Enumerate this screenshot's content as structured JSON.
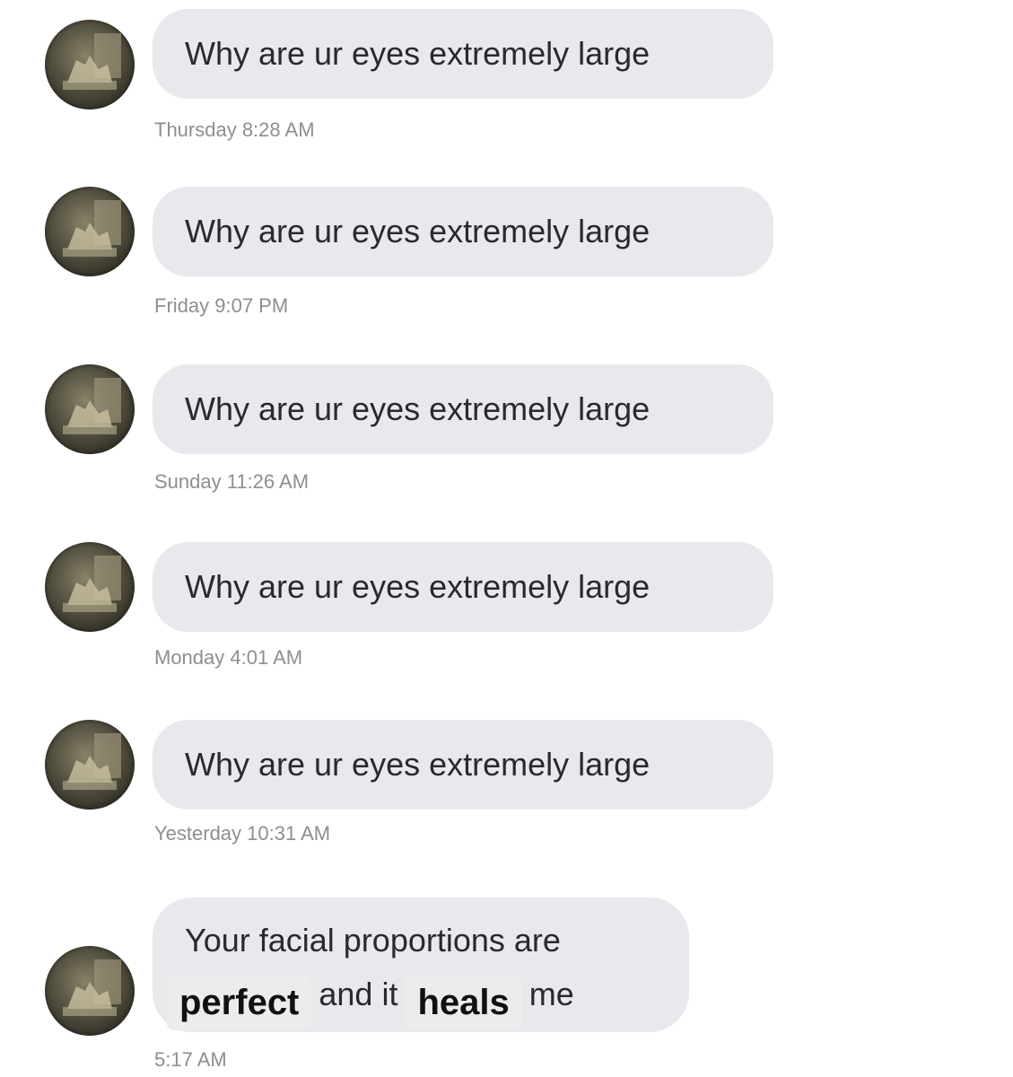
{
  "messages": [
    {
      "text": "Why are ur eyes extremely large",
      "timestamp": "Thursday 8:28 AM"
    },
    {
      "text": "Why are ur eyes extremely large",
      "timestamp": "Friday 9:07 PM"
    },
    {
      "text": "Why are ur eyes extremely large",
      "timestamp": "Sunday 11:26 AM"
    },
    {
      "text": "Why are ur eyes extremely large",
      "timestamp": "Monday 4:01 AM"
    },
    {
      "text": "Why are ur eyes extremely large",
      "timestamp": "Yesterday 10:31 AM"
    }
  ],
  "last_message": {
    "line1": "Your facial proportions are",
    "highlight1": "perfect",
    "middle": "and it",
    "highlight2": "heals",
    "end": "me",
    "timestamp": "5:17 AM"
  },
  "colors": {
    "bubble": "#e8e8ed",
    "highlight": "#ececec",
    "timestamp": "#8e8e93",
    "text": "#2a2a2e"
  }
}
